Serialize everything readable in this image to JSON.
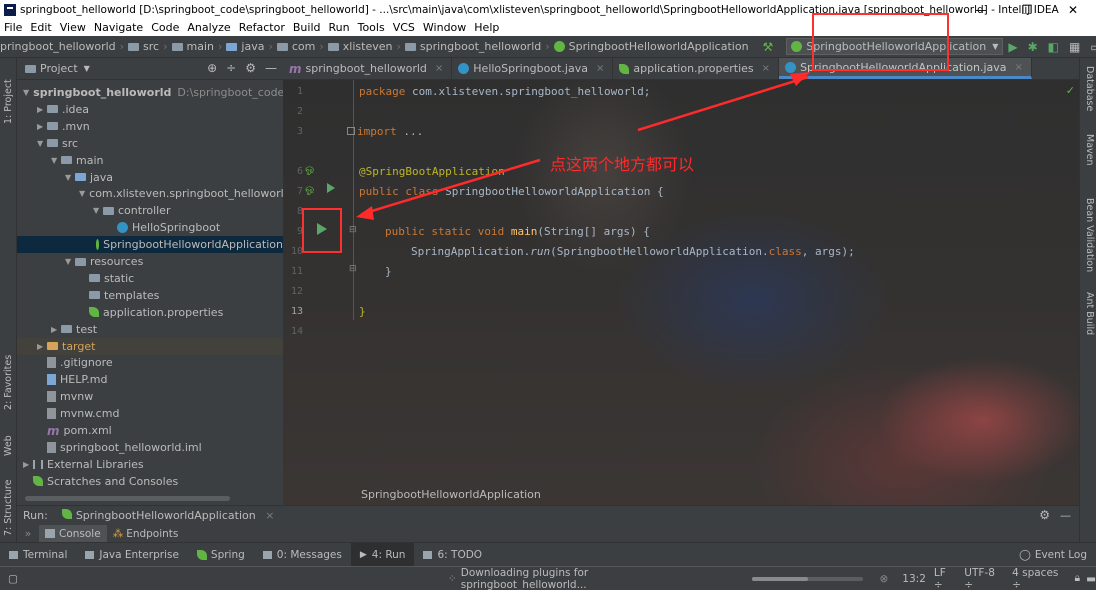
{
  "window": {
    "title": "springboot_helloworld [D:\\springboot_code\\springboot_helloworld] - ...\\src\\main\\java\\com\\xlisteven\\springboot_helloworld\\SpringbootHelloworldApplication.java [springboot_helloworld] - IntelliJ IDEA",
    "minimize": "—",
    "maximize": "❐",
    "close": "✕"
  },
  "menu": [
    "File",
    "Edit",
    "View",
    "Navigate",
    "Code",
    "Analyze",
    "Refactor",
    "Build",
    "Run",
    "Tools",
    "VCS",
    "Window",
    "Help"
  ],
  "nav": {
    "crumbs": [
      "pringboot_helloworld",
      "src",
      "main",
      "java",
      "com",
      "xlisteven",
      "springboot_helloworld",
      "SpringbootHelloworldApplication"
    ],
    "run_config": "SpringbootHelloworldApplication"
  },
  "left_tabs": {
    "project": "1: Project",
    "favorites": "2: Favorites",
    "web": "Web",
    "structure": "7: Structure"
  },
  "right_tabs": [
    "Database",
    "Maven",
    "Bean Validation",
    "Ant Build"
  ],
  "project": {
    "header": "Project",
    "tree": [
      {
        "label": "springboot_helloworld",
        "extra": "D:\\springboot_code\\spri",
        "depth": 0,
        "icon": "folder",
        "expanded": true,
        "bold": true
      },
      {
        "label": ".idea",
        "depth": 1,
        "icon": "folder",
        "expanded": false
      },
      {
        "label": ".mvn",
        "depth": 1,
        "icon": "folder",
        "expanded": false
      },
      {
        "label": "src",
        "depth": 1,
        "icon": "folder",
        "expanded": true
      },
      {
        "label": "main",
        "depth": 2,
        "icon": "folder",
        "expanded": true
      },
      {
        "label": "java",
        "depth": 3,
        "icon": "folder-blue",
        "expanded": true
      },
      {
        "label": "com.xlisteven.springboot_helloworld",
        "depth": 4,
        "icon": "folder",
        "expanded": true
      },
      {
        "label": "controller",
        "depth": 5,
        "icon": "folder",
        "expanded": true
      },
      {
        "label": "HelloSpringboot",
        "depth": 6,
        "icon": "class",
        "leaf": true
      },
      {
        "label": "SpringbootHelloworldApplication",
        "depth": 5,
        "icon": "class-spring",
        "leaf": true,
        "selected": true
      },
      {
        "label": "resources",
        "depth": 3,
        "icon": "folder",
        "expanded": true
      },
      {
        "label": "static",
        "depth": 4,
        "icon": "folder",
        "leaf": true
      },
      {
        "label": "templates",
        "depth": 4,
        "icon": "folder",
        "leaf": true
      },
      {
        "label": "application.properties",
        "depth": 4,
        "icon": "spring-leaf",
        "leaf": true
      },
      {
        "label": "test",
        "depth": 2,
        "icon": "folder",
        "expanded": false
      },
      {
        "label": "target",
        "depth": 1,
        "icon": "folder-orange",
        "expanded": false,
        "target": true
      },
      {
        "label": ".gitignore",
        "depth": 1,
        "icon": "file",
        "leaf": true
      },
      {
        "label": "HELP.md",
        "depth": 1,
        "icon": "file-md",
        "leaf": true
      },
      {
        "label": "mvnw",
        "depth": 1,
        "icon": "file",
        "leaf": true
      },
      {
        "label": "mvnw.cmd",
        "depth": 1,
        "icon": "file",
        "leaf": true
      },
      {
        "label": "pom.xml",
        "depth": 1,
        "icon": "file-maven",
        "leaf": true
      },
      {
        "label": "springboot_helloworld.iml",
        "depth": 1,
        "icon": "file",
        "leaf": true
      },
      {
        "label": "External Libraries",
        "depth": 0,
        "icon": "library",
        "expanded": false
      },
      {
        "label": "Scratches and Consoles",
        "depth": 0,
        "icon": "scratch",
        "leaf": true
      }
    ]
  },
  "editor": {
    "tabs": [
      {
        "label": "springboot_helloworld",
        "icon": "m",
        "active": false
      },
      {
        "label": "HelloSpringboot.java",
        "icon": "class",
        "active": false
      },
      {
        "label": "application.properties",
        "icon": "spring-leaf",
        "active": false
      },
      {
        "label": "SpringbootHelloworldApplication.java",
        "icon": "class",
        "active": true
      }
    ],
    "line_numbers": [
      "1",
      "2",
      "3",
      "6",
      "7",
      "8",
      "9",
      "10",
      "11",
      "12",
      "13",
      "14"
    ],
    "code": {
      "l1_kw": "package",
      "l1_rest": " com.xlisteven.springboot_helloworld;",
      "l3_kw": "import",
      "l3_rest": " ...",
      "l7_ann": "@SpringBootApplication",
      "l8_kw": "public class",
      "l8_rest": " SpringbootHelloworldApplication {",
      "l10_kw": "public static void",
      "l10_method": " main",
      "l10_rest": "(String[] args) {",
      "l11_pre": "SpringApplication.",
      "l11_run": "run",
      "l11_mid": "(SpringbootHelloworldApplication.",
      "l11_class": "class",
      "l11_post": ", args);",
      "l12": "}",
      "l14": "}"
    },
    "bottom_breadcrumb": "SpringbootHelloworldApplication"
  },
  "annotation": {
    "text": "点这两个地方都可以"
  },
  "run_panel": {
    "label": "Run:",
    "config": "SpringbootHelloworldApplication",
    "tabs": [
      "Console",
      "Endpoints"
    ]
  },
  "bottom_tools": [
    {
      "label": "Terminal",
      "active": false
    },
    {
      "label": "Java Enterprise",
      "active": false
    },
    {
      "label": "Spring",
      "active": false
    },
    {
      "label": "0: Messages",
      "active": false
    },
    {
      "label": "4: Run",
      "active": true
    },
    {
      "label": "6: TODO",
      "active": false
    }
  ],
  "event_log": "Event Log",
  "status": {
    "message": "Downloading plugins for springboot_helloworld...",
    "progress": 0.5,
    "position": "13:2",
    "line_sep": "LF ÷",
    "encoding": "UTF-8 ÷",
    "indent": "4 spaces ÷"
  },
  "colors": {
    "accent": "#4a88c7",
    "run_green": "#59a869",
    "annotation_red": "#ff2a2a"
  }
}
